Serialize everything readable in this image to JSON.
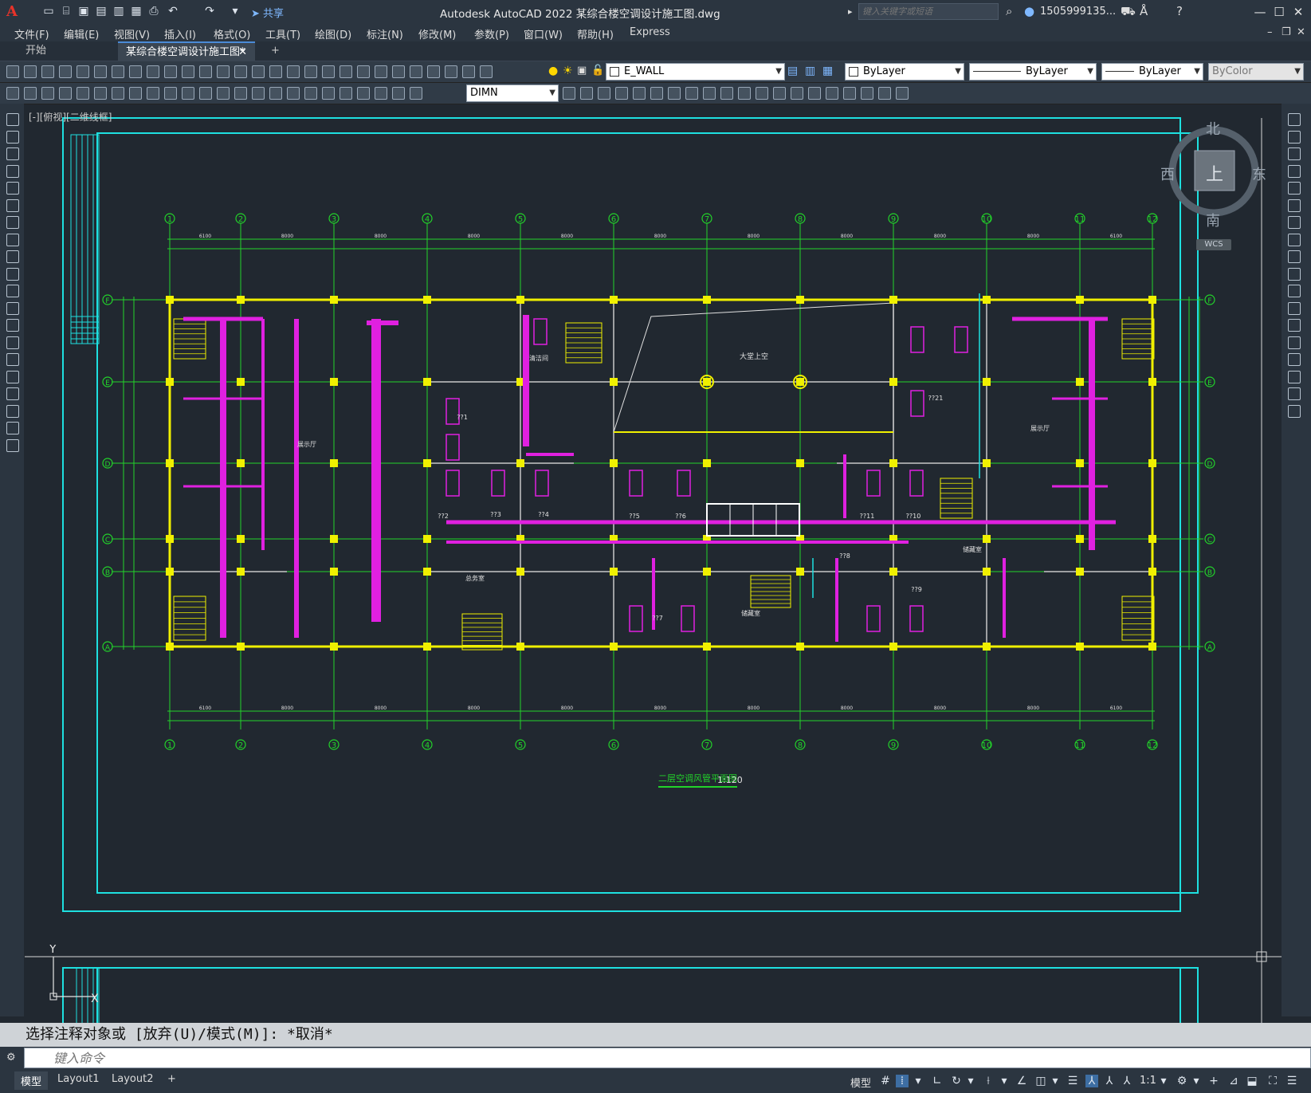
{
  "app": {
    "title": "Autodesk AutoCAD 2022    某综合楼空调设计施工图.dwg",
    "logo": "A",
    "share": "共享",
    "search_placeholder": "键入关键字或短语",
    "user": "1505999135...",
    "window_controls": [
      "minimize-icon",
      "maximize-icon",
      "close-icon"
    ]
  },
  "menu": [
    "文件(F)",
    "编辑(E)",
    "视图(V)",
    "插入(I)",
    "格式(O)",
    "工具(T)",
    "绘图(D)",
    "标注(N)",
    "修改(M)",
    "参数(P)",
    "窗口(W)",
    "帮助(H)",
    "Express"
  ],
  "tabs": {
    "start": "开始",
    "active": "某综合楼空调设计施工图*",
    "add": "+"
  },
  "toolbar": {
    "layer": "E_WALL",
    "color": "ByLayer",
    "linetype": "ByLayer",
    "lineweight": "ByLayer",
    "plotstyle": "ByColor",
    "dimstyle": "DIMN"
  },
  "drawing": {
    "viewport_label": "[-][俯视][二维线框]",
    "plan_title": "二层空调风管平面图",
    "scale": "1:120",
    "col_axes": [
      "1",
      "2",
      "3",
      "4",
      "5",
      "6",
      "7",
      "8",
      "9",
      "10",
      "11",
      "12"
    ],
    "row_axes": [
      "F",
      "E",
      "D",
      "C",
      "B",
      "A"
    ],
    "top_dims": [
      "6100",
      "8000",
      "8000",
      "8000",
      "8000",
      "8000",
      "8000",
      "8000",
      "8000",
      "8000",
      "6100"
    ],
    "room_labels": [
      "展示厅",
      "大堂上空",
      "展示厅",
      "??1",
      "??2",
      "??3",
      "??4",
      "??5",
      "??6",
      "??7",
      "??8",
      "??9",
      "??10",
      "??11",
      "??21",
      "清洁间",
      "储藏室",
      "总务室",
      "储藏室"
    ]
  },
  "viewcube": {
    "north": "北",
    "south": "南",
    "east": "东",
    "west": "西",
    "face": "上",
    "wcs": "WCS"
  },
  "command": {
    "history": "选择注释对象或 [放弃(U)/模式(M)]: *取消*",
    "placeholder": "键入命令"
  },
  "status": {
    "layout_tabs": [
      "模型",
      "Layout1",
      "Layout2"
    ],
    "add_layout": "+",
    "model": "模型",
    "annotation_scale": "1:1"
  },
  "colors": {
    "grid_green": "#22d32a",
    "wall_yellow": "#f0f000",
    "duct_magenta": "#e020e0",
    "frame_cyan": "#1ee0e0",
    "background": "#212830"
  }
}
